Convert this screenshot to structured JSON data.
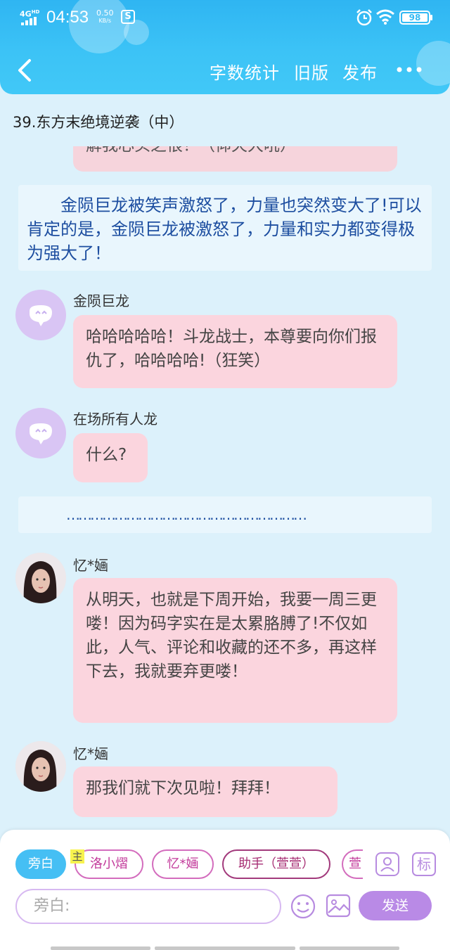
{
  "status_bar": {
    "network": "4G",
    "network_sup": "HD",
    "time": "04:53",
    "speed_value": "0.50",
    "speed_unit": "KB/s",
    "s_icon": "S",
    "battery": "98"
  },
  "toolbar": {
    "word_count": "字数统计",
    "old_version": "旧版",
    "publish": "发布"
  },
  "chapter": {
    "title": "39.东方末绝境逆袭（中）"
  },
  "messages": {
    "partial_top": "解我心头之恨！（仰天大吼）",
    "narration1": "　　金陨巨龙被笑声激怒了，力量也突然变大了!可以肯定的是，金陨巨龙被激怒了，力量和实力都变得极为强大了！",
    "speaker1": "金陨巨龙",
    "text1": "哈哈哈哈哈！斗龙战士，本尊要向你们报仇了，哈哈哈哈!（狂笑）",
    "speaker2": "在场所有人龙",
    "text2": "什么?",
    "dots": "……………………………………………………",
    "speaker3": "忆*婳",
    "text3": "从明天，也就是下周开始，我要一周三更喽！因为码字实在是太累胳膊了!不仅如此，人气、评论和收藏的还不多，再这样下去，我就要弃更喽！",
    "speaker4": "忆*婳",
    "text4": "那我们就下次见啦！拜拜！"
  },
  "bottom": {
    "chips": [
      "旁白",
      "洛小熠",
      "忆*婳",
      "助手（萱萱）",
      "萱"
    ],
    "main_badge": "主",
    "tag_label": "标",
    "input_placeholder": "旁白:",
    "send": "发送"
  },
  "icons": {
    "back": "chevron-left-icon",
    "more": "more-dots-icon",
    "alarm": "alarm-icon",
    "wifi": "wifi-icon",
    "emoji": "emoji-icon",
    "image": "image-icon",
    "user_card": "user-card-icon"
  },
  "colors": {
    "header": "#3cc3f6",
    "background": "#dcf1fb",
    "bubble": "#fbd5de",
    "narration_text": "#1d4ea0",
    "send": "#b98ae6"
  }
}
